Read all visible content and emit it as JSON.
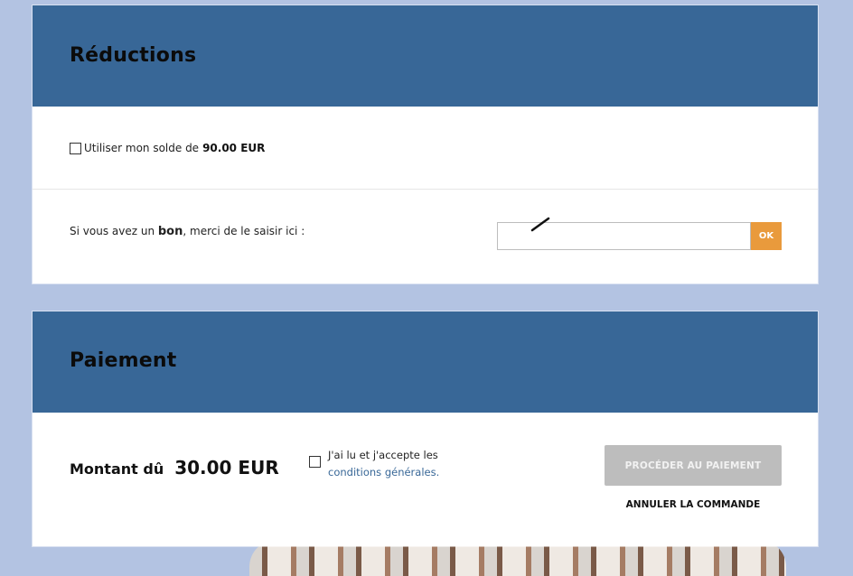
{
  "reductions": {
    "title": "Réductions",
    "balance": {
      "label_prefix": "Utiliser mon solde de",
      "amount": "90.00 EUR",
      "checked": false
    },
    "voucher": {
      "prefix": "Si vous avez un",
      "bold_word": "bon",
      "suffix": ", merci de le saisir ici :",
      "input_value": "",
      "ok_label": "OK"
    }
  },
  "payment": {
    "title": "Paiement",
    "amount_due_label": "Montant dû",
    "amount_due_value": "30.00 EUR",
    "terms": {
      "text": "J'ai lu et j'accepte les",
      "link": "conditions générales.",
      "checked": false
    },
    "proceed_label": "PROCÉDER AU PAIEMENT",
    "cancel_label": "ANNULER LA COMMANDE"
  },
  "colors": {
    "header_bg": "#386797",
    "page_bg": "#b3c3e2",
    "ok_button": "#e99a3c",
    "proceed_disabled": "#bdbdbd",
    "link": "#386797"
  }
}
